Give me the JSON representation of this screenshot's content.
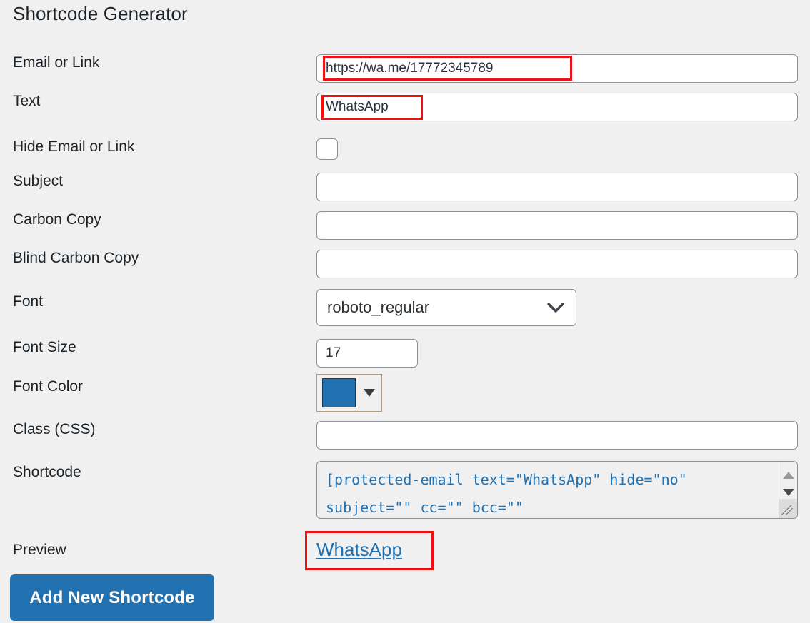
{
  "page": {
    "title": "Shortcode Generator",
    "background_color": "#f0f0f1",
    "accent_color": "#2271b1",
    "annotation_color": "#ee1111"
  },
  "form": {
    "rows": [
      {
        "label": "Email or Link"
      },
      {
        "label": "Text"
      },
      {
        "label": "Hide Email or Link"
      },
      {
        "label": "Subject"
      },
      {
        "label": "Carbon Copy"
      },
      {
        "label": "Blind Carbon Copy"
      },
      {
        "label": "Font"
      },
      {
        "label": "Font Size"
      },
      {
        "label": "Font Color"
      },
      {
        "label": "Class (CSS)"
      },
      {
        "label": "Shortcode"
      },
      {
        "label": "Preview"
      }
    ],
    "email_or_link": {
      "value": "https://wa.me/17772345789",
      "placeholder": ""
    },
    "text": {
      "value": "WhatsApp",
      "placeholder": ""
    },
    "hide_email_or_link": {
      "checked": false
    },
    "subject": {
      "value": "",
      "placeholder": ""
    },
    "carbon_copy": {
      "value": "",
      "placeholder": ""
    },
    "blind_carbon_copy": {
      "value": "",
      "placeholder": ""
    },
    "font": {
      "value": "roboto_regular",
      "icon": "chevron-down-icon"
    },
    "font_size": {
      "value": "17",
      "placeholder": ""
    },
    "font_color": {
      "value": "#2271b1",
      "icon": "caret-down-icon"
    },
    "class_css": {
      "value": "",
      "placeholder": ""
    },
    "shortcode": {
      "value": "[protected-email text=\"WhatsApp\" hide=\"no\" subject=\"\" cc=\"\" bcc=\"\"",
      "scroll_up_icon": "scroll-up-arrow-icon",
      "scroll_down_icon": "scroll-down-arrow-icon",
      "resize_icon": "resize-grip-icon"
    },
    "preview": {
      "link_text": "WhatsApp"
    }
  },
  "actions": {
    "add_new_shortcode": "Add New Shortcode"
  }
}
